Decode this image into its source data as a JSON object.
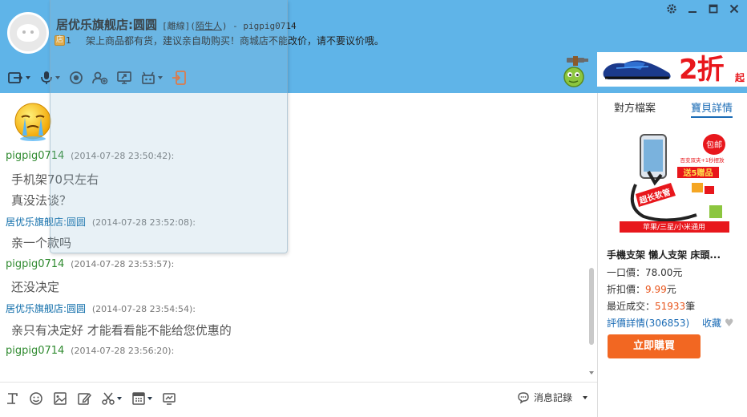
{
  "header": {
    "shop_title": "居优乐旗舰店:圆圆",
    "status_prefix": "[離線](",
    "relation": "陌生人",
    "status_suffix": ") - pigpig0714",
    "badge": "店",
    "badge_level": "1",
    "notice": "架上商品都有货，建议亲自助购买！商城店不能改价，请不要议价哦。"
  },
  "ad": {
    "big": "2折",
    "small": "起"
  },
  "chat": {
    "messages": [
      {
        "sender": "pigpig0714",
        "role": "buyer",
        "time": "(2014-07-28 23:50:42):",
        "lines": [
          "手机架70只左右",
          "真没法谈？"
        ]
      },
      {
        "sender": "居优乐旗舰店:圆圆",
        "role": "seller",
        "time": "(2014-07-28 23:52:08):",
        "lines": [
          "亲一个款吗"
        ]
      },
      {
        "sender": "pigpig0714",
        "role": "buyer",
        "time": "(2014-07-28 23:53:57):",
        "lines": [
          "还没决定"
        ]
      },
      {
        "sender": "居优乐旗舰店:圆圆",
        "role": "seller",
        "time": "(2014-07-28 23:54:54):",
        "lines": [
          "亲只有决定好  才能看看能不能给您优惠的"
        ]
      },
      {
        "sender": "pigpig0714",
        "role": "buyer",
        "time": "(2014-07-28 23:56:20):",
        "lines": []
      }
    ]
  },
  "input_toolbar": {
    "history_label": "消息記錄"
  },
  "right_panel": {
    "tabs": [
      "對方檔案",
      "寶貝詳情"
    ],
    "active_tab": 1,
    "product_image_texts": {
      "free_ship": "包邮",
      "promo1": "百变双夹+1秒摆放",
      "promo2": "送5赠品",
      "long_pipe": "超长软管",
      "compat": "苹果/三星/小米通用"
    },
    "product_title": "手機支架 懶人支架 床頭...",
    "price_label": "一口價：",
    "price": "78.00元",
    "discount_label": "折扣價：",
    "discount_price": "9.99",
    "discount_unit": "元",
    "recent_label": "最近成交：",
    "recent_count": "51933",
    "recent_unit": "筆",
    "reviews_label": "評價詳情(306853)",
    "favorite_label": "收藏",
    "buy_label": "立即購買"
  },
  "colors": {
    "header_bg": "#5fb4e8",
    "buyer_name": "#2f8a2f",
    "seller_name": "#0a6aa8",
    "link": "#1a6bb5",
    "buy_button": "#f26722",
    "ad_red": "#e8171c"
  },
  "icons": {
    "window": [
      "settings-icon",
      "minimize-icon",
      "maximize-icon",
      "close-icon"
    ],
    "toolbar": [
      "transfer-file-icon",
      "voice-icon",
      "video-icon",
      "add-contact-icon",
      "screen-share-icon",
      "remote-assist-icon",
      "more-apps-icon"
    ],
    "input": [
      "font-icon",
      "emoji-icon",
      "image-icon",
      "edit-icon",
      "scissors-icon",
      "calculator-icon",
      "screenshot-icon",
      "chat-history-icon"
    ]
  }
}
